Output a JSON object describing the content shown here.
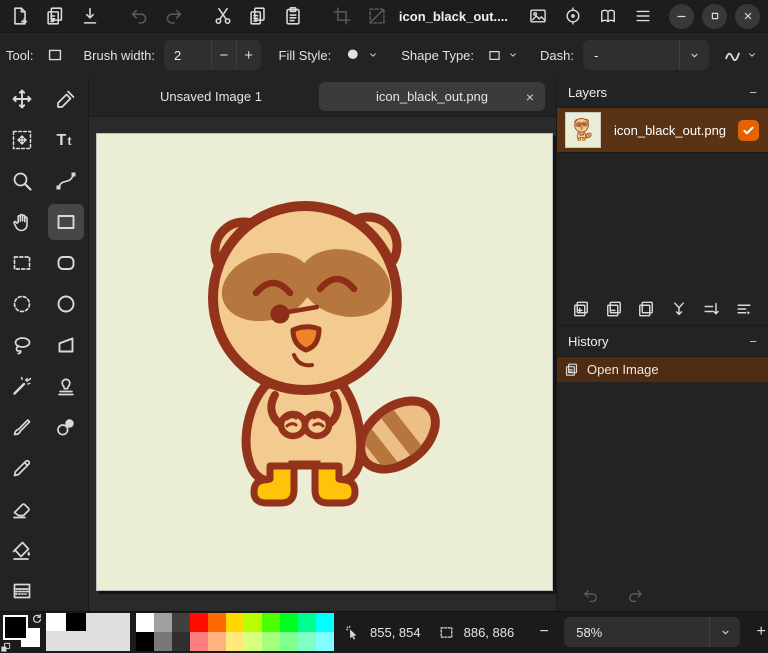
{
  "titlebar": {
    "title": "icon_black_out....",
    "left_icons": [
      {
        "icon": "new-image"
      },
      {
        "icon": "open-image"
      },
      {
        "icon": "save"
      },
      {
        "icon": "undo",
        "disabled": true,
        "gap": true
      },
      {
        "icon": "redo",
        "disabled": true
      },
      {
        "icon": "cut",
        "gap": true
      },
      {
        "icon": "copy"
      },
      {
        "icon": "paste"
      },
      {
        "icon": "crop-to-selection",
        "disabled": true,
        "gap": true
      },
      {
        "icon": "deselect",
        "disabled": true
      }
    ],
    "right_icons": [
      "image-menu",
      "adjustments-menu",
      "add-ins-menu",
      "main-menu"
    ],
    "window_controls": [
      "minimize",
      "maximize",
      "close"
    ]
  },
  "toolbar": {
    "tool_label": "Tool:",
    "brush_width": {
      "label": "Brush width:",
      "value": "2",
      "decrease": "−",
      "increase": "+"
    },
    "fill_style": {
      "label": "Fill Style:"
    },
    "shape_type": {
      "label": "Shape Type:"
    },
    "dash": {
      "label": "Dash:",
      "value": "-"
    }
  },
  "tabs": {
    "inactive_label": "Unsaved Image 1",
    "active_label": "icon_black_out.png",
    "close_glyph": "×"
  },
  "tools": [
    {
      "icon": "move-selected"
    },
    {
      "icon": "color-picker"
    },
    {
      "icon": "move-selection"
    },
    {
      "icon": "text"
    },
    {
      "icon": "zoom"
    },
    {
      "icon": "line-curve"
    },
    {
      "icon": "pan"
    },
    {
      "icon": "rectangle",
      "selected": true
    },
    {
      "icon": "rectangle-select"
    },
    {
      "icon": "rounded-rectangle"
    },
    {
      "icon": "ellipse-select"
    },
    {
      "icon": "ellipse"
    },
    {
      "icon": "lasso-select"
    },
    {
      "icon": "freeform-shape"
    },
    {
      "icon": "magic-wand"
    },
    {
      "icon": "clone-stamp"
    },
    {
      "icon": "paintbrush"
    },
    {
      "icon": "recolor"
    },
    {
      "icon": "pencil"
    },
    null,
    {
      "icon": "eraser"
    },
    null,
    {
      "icon": "paint-bucket"
    },
    null,
    {
      "icon": "gradient"
    },
    null
  ],
  "layers_panel": {
    "title": "Layers",
    "collapse_glyph": "−",
    "layer": {
      "name": "icon_black_out.png",
      "visible": true
    },
    "buttons": [
      "add-layer",
      "delete-layer",
      "duplicate-layer",
      "merge-layer-down",
      "move-layer",
      "layer-properties"
    ]
  },
  "history_panel": {
    "title": "History",
    "collapse_glyph": "−",
    "item": {
      "label": "Open Image",
      "selected": true
    }
  },
  "statusbar": {
    "cursor_position": "855, 854",
    "selection_size": "886, 886",
    "zoom": {
      "value": "58%",
      "decrease": "−",
      "increase": "+"
    }
  },
  "colors": {
    "accent_orange": "#e66100",
    "selected_layer_bg": "#5a3315",
    "selected_history_bg": "#4f2b11"
  },
  "palette": {
    "primary": "#000000",
    "secondary": "#ffffff",
    "recent": [
      "#ffffff",
      "#000000"
    ],
    "grid": [
      [
        "#ffffff",
        "#a0a0a0",
        "#404040",
        "#ff0d00",
        "#ff6a00",
        "#ffd800",
        "#b6ff00",
        "#4cff00",
        "#00ff21",
        "#00ff90",
        "#00ffff"
      ],
      [
        "#000000",
        "#787878",
        "#303030",
        "#ff7f7f",
        "#ffb27f",
        "#ffe97f",
        "#daff7f",
        "#a5ff7f",
        "#7fff8e",
        "#7fffc5",
        "#7fffff"
      ]
    ]
  },
  "canvas": {
    "background": "#ebeed4",
    "artwork": "tanuki-character",
    "colors": {
      "outline": "#93331b",
      "fur": "#f3ca90",
      "patch": "#b5773e",
      "inner_ear": "#a4602c",
      "eyes": "#8c2d15",
      "tongue": "#f0822a",
      "boots": "#ffc30a",
      "tail_light": "#edbe85"
    }
  }
}
